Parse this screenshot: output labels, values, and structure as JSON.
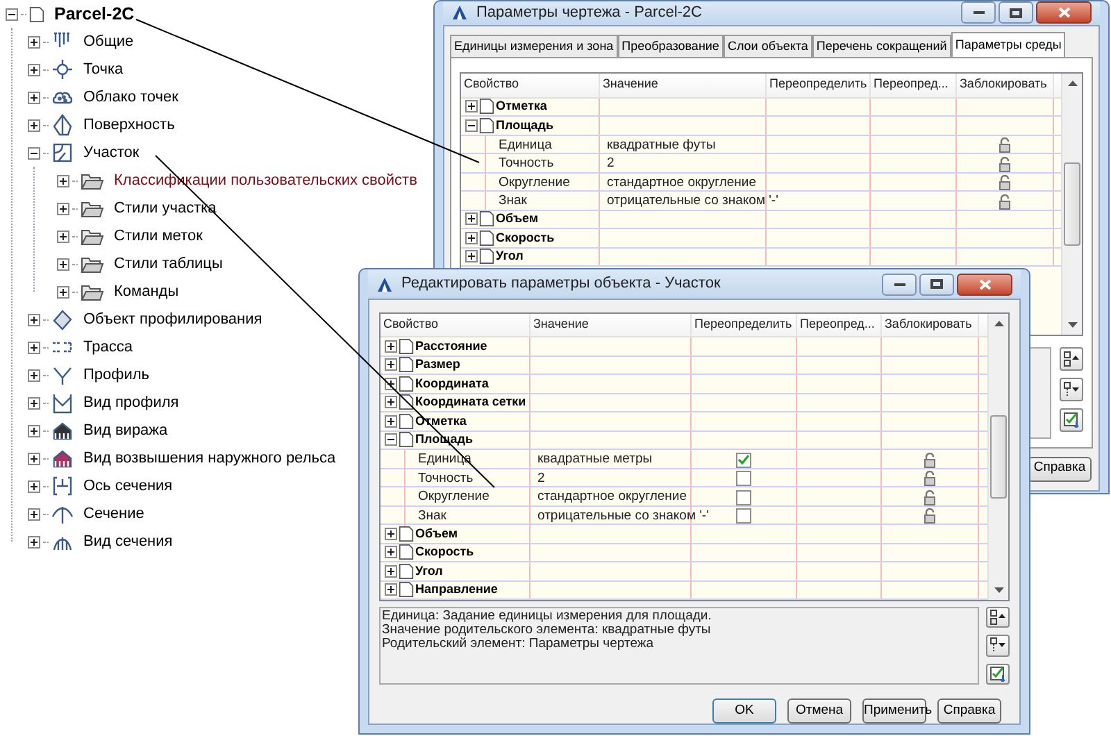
{
  "tree": {
    "label": "Parcel-2C",
    "expanded": true,
    "children": [
      {
        "label": "Общие",
        "expanded": false
      },
      {
        "label": "Точка",
        "expanded": false
      },
      {
        "label": "Облако точек",
        "expanded": false
      },
      {
        "label": "Поверхность",
        "expanded": false
      },
      {
        "label": "Участок",
        "expanded": true,
        "children": [
          {
            "label": "Классификации пользовательских свойств",
            "expanded": false,
            "highlighted": true
          },
          {
            "label": "Стили участка",
            "expanded": false,
            "highlighted": false
          },
          {
            "label": "Стили меток",
            "expanded": false,
            "highlighted": false
          },
          {
            "label": "Стили таблицы",
            "expanded": false,
            "highlighted": false
          },
          {
            "label": "Команды",
            "expanded": false,
            "highlighted": false
          }
        ]
      },
      {
        "label": "Объект профилирования",
        "expanded": false
      },
      {
        "label": "Трасса",
        "expanded": false
      },
      {
        "label": "Профиль",
        "expanded": false
      },
      {
        "label": "Вид профиля",
        "expanded": false
      },
      {
        "label": "Вид виража",
        "expanded": false
      },
      {
        "label": "Вид возвышения наружного рельса",
        "expanded": false
      },
      {
        "label": "Ось сечения",
        "expanded": false
      },
      {
        "label": "Сечение",
        "expanded": false
      },
      {
        "label": "Вид сечения",
        "expanded": false
      }
    ]
  },
  "drawing_settings": {
    "title": "Параметры чертежа - Parcel-2C",
    "tabs": [
      {
        "label": "Единицы измерения и зона",
        "selected": false
      },
      {
        "label": "Преобразование",
        "selected": false
      },
      {
        "label": "Слои объекта",
        "selected": false
      },
      {
        "label": "Перечень сокращений",
        "selected": false
      },
      {
        "label": "Параметры среды",
        "selected": true
      }
    ],
    "columns": [
      "Свойство",
      "Значение",
      "Переопределить",
      "Переопред...",
      "Заблокировать"
    ],
    "rows": [
      {
        "kind": "group",
        "name": "Отметка",
        "expanded": false
      },
      {
        "kind": "group",
        "name": "Площадь",
        "expanded": true
      },
      {
        "kind": "property",
        "name": "Единица",
        "value": "квадратные футы"
      },
      {
        "kind": "property",
        "name": "Точность",
        "value": "2"
      },
      {
        "kind": "property",
        "name": "Округление",
        "value": "стандартное округление"
      },
      {
        "kind": "property",
        "name": "Знак",
        "value": "отрицательные со знаком '-'"
      },
      {
        "kind": "group",
        "name": "Объем",
        "expanded": false
      },
      {
        "kind": "group",
        "name": "Скорость",
        "expanded": false
      },
      {
        "kind": "group",
        "name": "Угол",
        "expanded": false
      }
    ],
    "buttons": [
      "Справка"
    ]
  },
  "object_settings": {
    "title": "Редактировать параметры объекта - Участок",
    "columns": [
      "Свойство",
      "Значение",
      "Переопределить",
      "Переопред...",
      "Заблокировать"
    ],
    "rows": [
      {
        "kind": "group",
        "name": "Расстояние",
        "expanded": false
      },
      {
        "kind": "group",
        "name": "Размер",
        "expanded": false
      },
      {
        "kind": "group",
        "name": "Координата",
        "expanded": false
      },
      {
        "kind": "group",
        "name": "Координата сетки",
        "expanded": false
      },
      {
        "kind": "group",
        "name": "Отметка",
        "expanded": false
      },
      {
        "kind": "group",
        "name": "Площадь",
        "expanded": true
      },
      {
        "kind": "property",
        "name": "Единица",
        "value": "квадратные метры",
        "override": true
      },
      {
        "kind": "property",
        "name": "Точность",
        "value": "2",
        "override": false
      },
      {
        "kind": "property",
        "name": "Округление",
        "value": "стандартное округление",
        "override": false
      },
      {
        "kind": "property",
        "name": "Знак",
        "value": "отрицательные со знаком '-'",
        "override": false
      },
      {
        "kind": "group",
        "name": "Объем",
        "expanded": false
      },
      {
        "kind": "group",
        "name": "Скорость",
        "expanded": false
      },
      {
        "kind": "group",
        "name": "Угол",
        "expanded": false
      },
      {
        "kind": "group",
        "name": "Направление",
        "expanded": false
      }
    ],
    "description": [
      "Единица: Задание единицы измерения для площади.",
      "Значение родительского элемента: квадратные футы",
      "Родительский элемент: Параметры чертежа"
    ],
    "buttons": [
      "OK",
      "Отмена",
      "Применить",
      "Справка"
    ]
  }
}
